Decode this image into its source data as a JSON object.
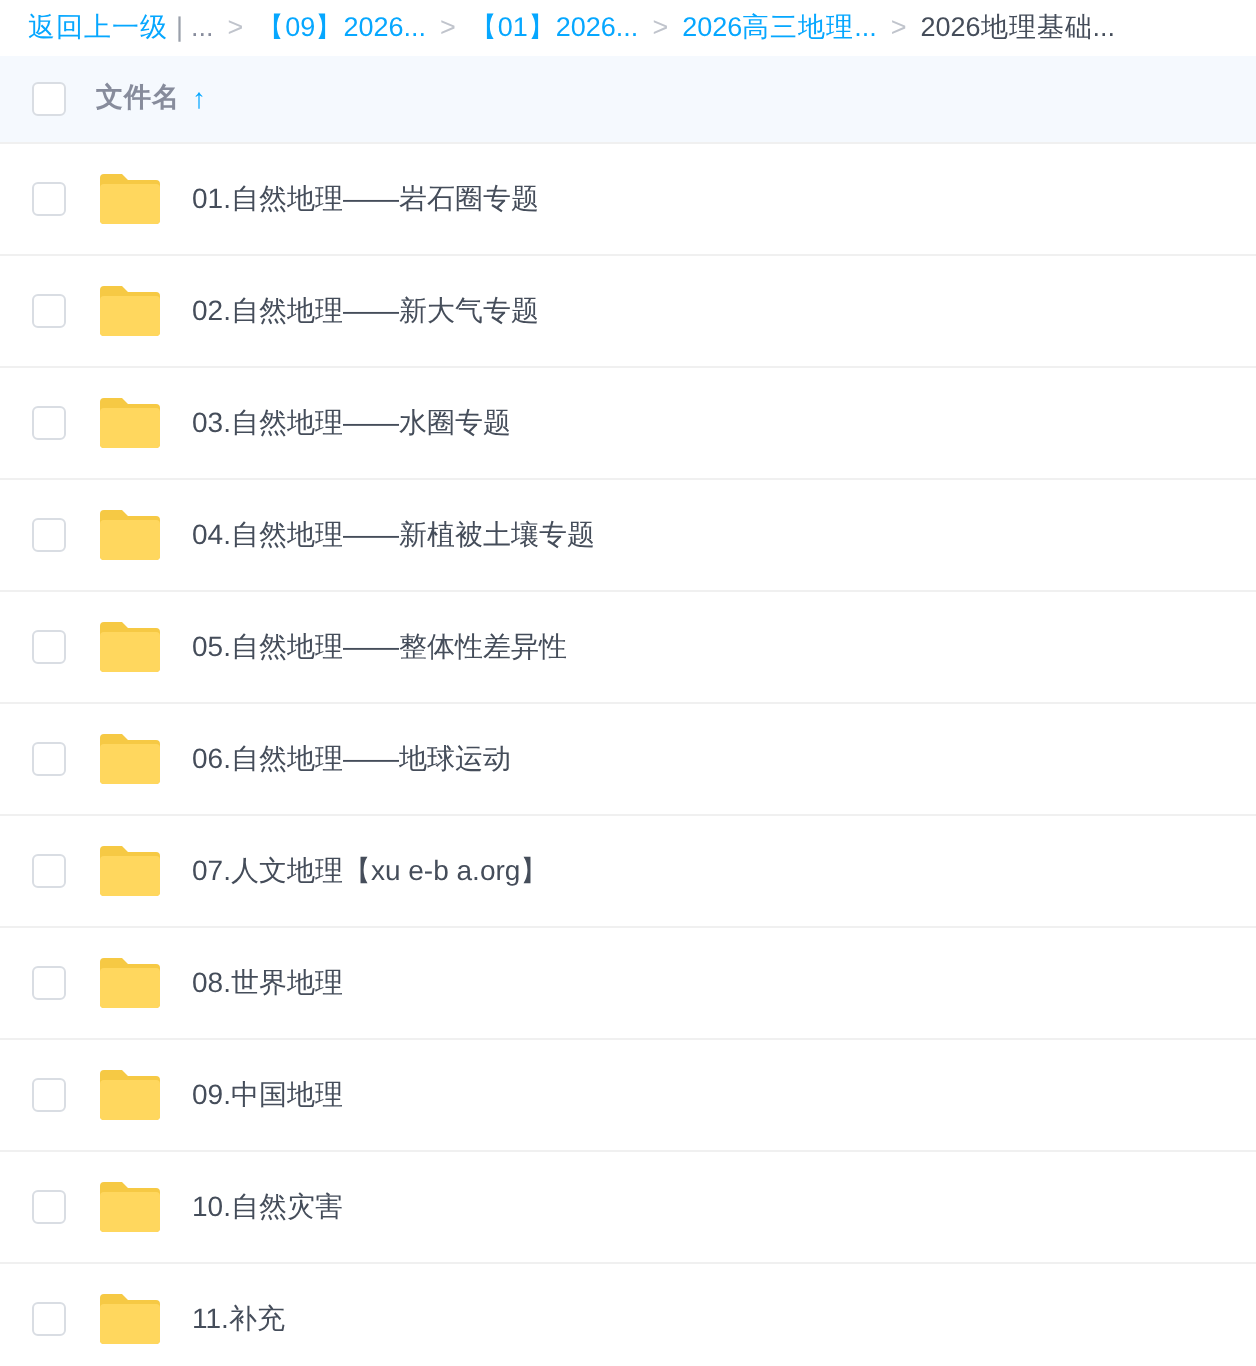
{
  "breadcrumb": {
    "back": "返回上一级",
    "divider": "|",
    "crumbs": [
      {
        "label": "...",
        "kind": "ellipsis"
      },
      {
        "sep": ">",
        "label": "【09】2026...",
        "kind": "link"
      },
      {
        "sep": ">",
        "label": "【01】2026...",
        "kind": "link"
      },
      {
        "sep": ">",
        "label": "2026高三地理...",
        "kind": "link"
      },
      {
        "sep": ">",
        "label": "2026地理基础...",
        "kind": "current"
      }
    ]
  },
  "header": {
    "checked": false,
    "column": "文件名",
    "sort_icon": "↑"
  },
  "rows": [
    {
      "name": "01.自然地理——岩石圈专题",
      "checked": false
    },
    {
      "name": "02.自然地理——新大气专题",
      "checked": false
    },
    {
      "name": "03.自然地理——水圈专题",
      "checked": false
    },
    {
      "name": "04.自然地理——新植被土壤专题",
      "checked": false
    },
    {
      "name": "05.自然地理——整体性差异性",
      "checked": false
    },
    {
      "name": "06.自然地理——地球运动",
      "checked": false
    },
    {
      "name": "07.人文地理【xu e-b a.org】",
      "checked": false
    },
    {
      "name": "08.世界地理",
      "checked": false
    },
    {
      "name": "09.中国地理",
      "checked": false
    },
    {
      "name": "10.自然灾害",
      "checked": false
    },
    {
      "name": "11.补充",
      "checked": false
    }
  ]
}
